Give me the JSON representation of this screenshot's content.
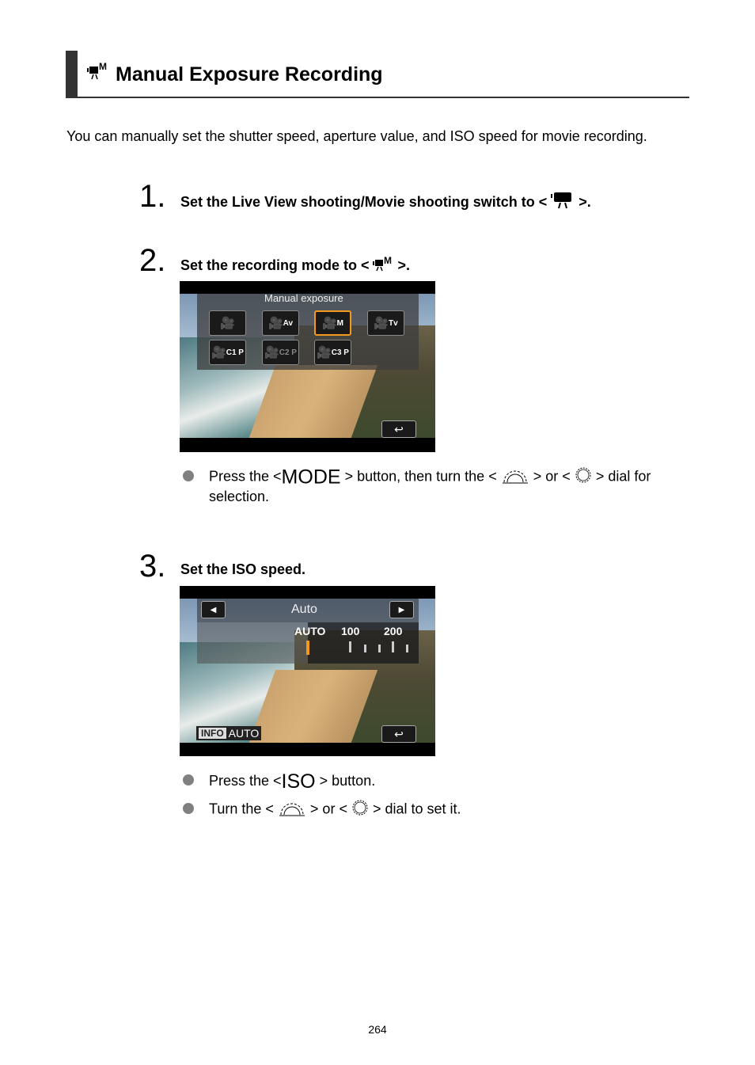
{
  "header": {
    "title": "Manual Exposure Recording",
    "title_icon": "movie-manual-icon"
  },
  "intro": "You can manually set the shutter speed, aperture value, and ISO speed for movie recording.",
  "steps": [
    {
      "number": "1.",
      "text_before": "Set the Live View shooting/Movie shooting switch to <",
      "icon": "movie-camera-icon",
      "text_after": ">."
    },
    {
      "number": "2.",
      "text_before": "Set the recording mode to <",
      "icon": "movie-manual-icon",
      "text_after": ">.",
      "screen": {
        "title": "Manual exposure",
        "modes": [
          {
            "label": "",
            "state": "normal"
          },
          {
            "label": "Av",
            "state": "normal"
          },
          {
            "label": "M",
            "state": "selected"
          },
          {
            "label": "Tv",
            "state": "normal"
          },
          {
            "label": "C1 P",
            "state": "normal"
          },
          {
            "label": "C2 P",
            "state": "dim"
          },
          {
            "label": "C3 P",
            "state": "normal"
          }
        ],
        "back_icon": "return-icon"
      },
      "bullets": [
        {
          "p1": "Press the <",
          "mode_word": "MODE",
          "p2": "> button, then turn the <",
          "p3": "> or <",
          "p4": "> dial for",
          "p5": "selection."
        }
      ]
    },
    {
      "number": "3.",
      "text": "Set the ISO speed.",
      "screen": {
        "title": "Auto",
        "scale_labels": [
          "AUTO",
          "100",
          "200"
        ],
        "info_label": "INFO",
        "info_value": "AUTO",
        "selected_value": "AUTO"
      },
      "bullets": [
        {
          "p1": "Press the <",
          "iso_word": "ISO",
          "p2": "> button."
        },
        {
          "p1": "Turn the <",
          "p2": "> or <",
          "p3": "> dial to set it."
        }
      ]
    }
  ],
  "page_number": "264"
}
